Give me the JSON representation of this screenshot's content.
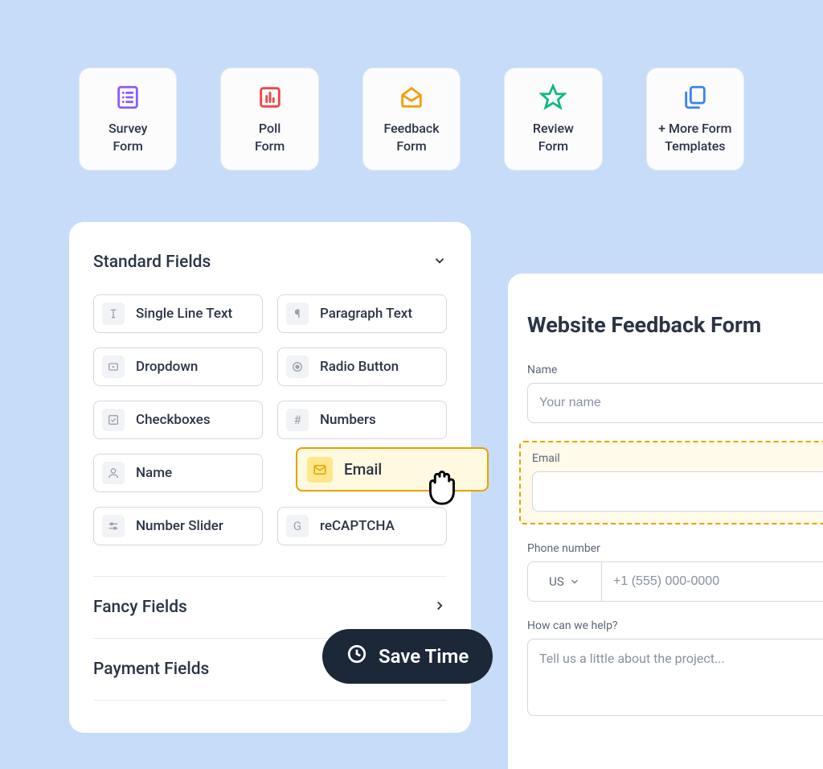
{
  "templates": [
    {
      "label": "Survey\nForm",
      "icon": "survey"
    },
    {
      "label": "Poll\nForm",
      "icon": "poll"
    },
    {
      "label": "Feedback\nForm",
      "icon": "feedback"
    },
    {
      "label": "Review\nForm",
      "icon": "review"
    },
    {
      "label": "+ More Form\nTemplates",
      "icon": "more"
    }
  ],
  "sections": {
    "standard": {
      "title": "Standard Fields"
    },
    "fancy": {
      "title": "Fancy Fields"
    },
    "payment": {
      "title": "Payment Fields"
    }
  },
  "fields": [
    {
      "label": "Single Line Text",
      "icon": "text"
    },
    {
      "label": "Paragraph Text",
      "icon": "paragraph"
    },
    {
      "label": "Dropdown",
      "icon": "dropdown"
    },
    {
      "label": "Radio Button",
      "icon": "radio"
    },
    {
      "label": "Checkboxes",
      "icon": "checkbox"
    },
    {
      "label": "Numbers",
      "icon": "hash"
    },
    {
      "label": "Name",
      "icon": "name"
    },
    {
      "label": "Email",
      "icon": "email"
    },
    {
      "label": "Number Slider",
      "icon": "slider"
    },
    {
      "label": "reCAPTCHA",
      "icon": "captcha"
    }
  ],
  "dragging": {
    "label": "Email"
  },
  "save_pill": {
    "label": "Save Time"
  },
  "preview": {
    "title": "Website Feedback Form",
    "name_label": "Name",
    "name_placeholder": "Your name",
    "email_label": "Email",
    "phone_label": "Phone number",
    "phone_prefix": "US",
    "phone_placeholder": "+1 (555) 000-0000",
    "help_label": "How can we help?",
    "help_placeholder": "Tell us a little about the project..."
  }
}
